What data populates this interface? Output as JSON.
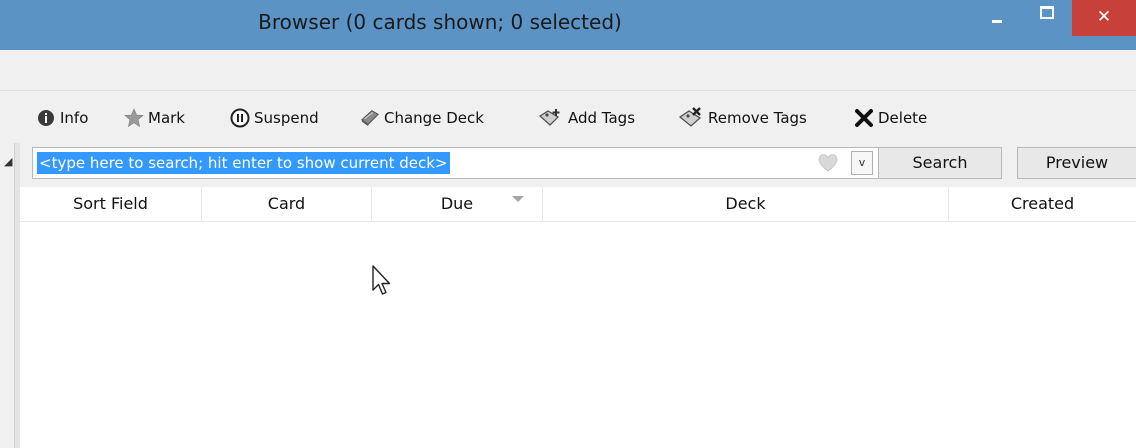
{
  "window": {
    "title": "Browser (0 cards shown; 0 selected)",
    "close_glyph": "✕",
    "colors": {
      "titlebar": "#5b93c5",
      "close": "#c7403a",
      "selection": "#3399ff"
    }
  },
  "toolbar": {
    "items": [
      {
        "label": "Info",
        "icon": "info-icon"
      },
      {
        "label": "Mark",
        "icon": "star-icon"
      },
      {
        "label": "Suspend",
        "icon": "pause-icon"
      },
      {
        "label": "Change Deck",
        "icon": "deck-icon"
      },
      {
        "label": "Add Tags",
        "icon": "add-tag-icon"
      },
      {
        "label": "Remove Tags",
        "icon": "remove-tag-icon"
      },
      {
        "label": "Delete",
        "icon": "x-icon"
      }
    ]
  },
  "search": {
    "value": "<type here to search; hit enter to show current deck>",
    "dropdown_glyph": "v",
    "search_button": "Search",
    "preview_button": "Preview"
  },
  "table": {
    "columns": [
      "Sort Field",
      "Card",
      "Due",
      "Deck",
      "Created"
    ],
    "sorted_column": "Due",
    "rows": []
  }
}
